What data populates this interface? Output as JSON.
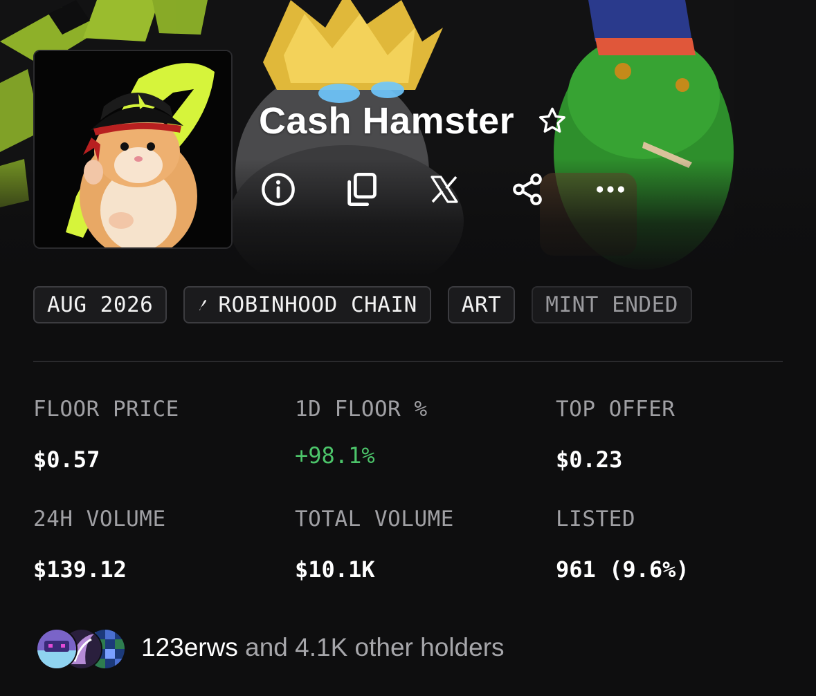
{
  "collection": {
    "name": "Cash Hamster"
  },
  "icons": {
    "favorite": "star-outline-icon",
    "actions": [
      "info-icon",
      "copy-icon",
      "x-logo-icon",
      "share-icon",
      "more-icon"
    ]
  },
  "tags": [
    {
      "label": "AUG 2026"
    },
    {
      "label": "ROBINHOOD CHAIN",
      "icon": "robinhood-feather-icon"
    },
    {
      "label": "ART"
    },
    {
      "label": "MINT ENDED",
      "muted": true
    }
  ],
  "stats": {
    "floor_price": {
      "label": "FLOOR PRICE",
      "value": "$0.57"
    },
    "floor_change_1d": {
      "label": "1D FLOOR %",
      "value": "+98.1%"
    },
    "top_offer": {
      "label": "TOP OFFER",
      "value": "$0.23"
    },
    "volume_24h": {
      "label": "24H VOLUME",
      "value": "$139.12"
    },
    "total_volume": {
      "label": "TOTAL VOLUME",
      "value": "$10.1K"
    },
    "listed": {
      "label": "LISTED",
      "value": "961 (9.6%)"
    }
  },
  "holders": {
    "first_holder": "123erws",
    "rest_text": " and 4.1K other holders"
  },
  "colors": {
    "background": "#0e0e0f",
    "positive": "#4cc46a",
    "brand_lime": "#ccf23c",
    "muted_text": "#a0a0a4"
  }
}
